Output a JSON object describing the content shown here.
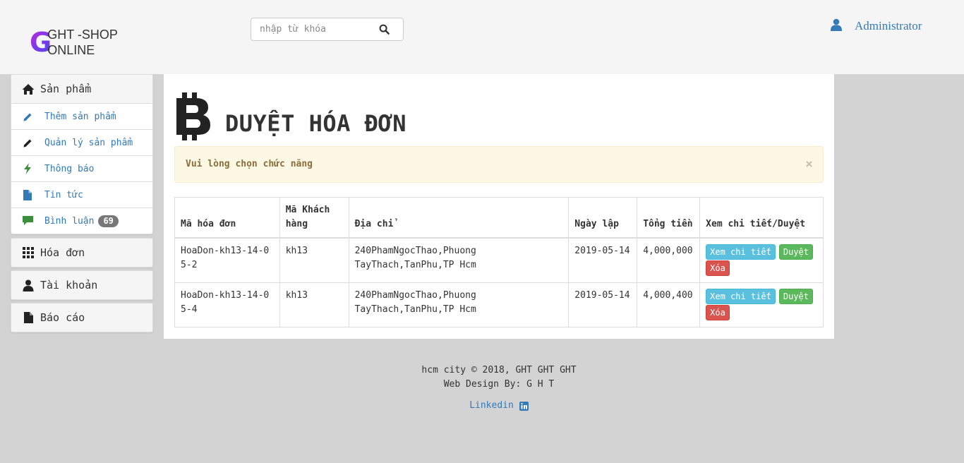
{
  "header": {
    "logo_letter": "G",
    "logo_line1": "GHT -SHOP",
    "logo_line2": "ONLINE",
    "search_placeholder": "nhập từ khóa",
    "user_name": "Administrator"
  },
  "sidebar": {
    "products": {
      "label": "Sản phẩm",
      "items": [
        {
          "label": "Thêm sản phẩm",
          "icon": "pencil-icon"
        },
        {
          "label": "Quản lý sản phẩm",
          "icon": "pencil-icon"
        },
        {
          "label": "Thông báo",
          "icon": "flash-icon"
        },
        {
          "label": "Tin tức",
          "icon": "file-icon"
        },
        {
          "label": "Bình luận",
          "icon": "comment-icon",
          "badge": "69"
        }
      ]
    },
    "invoices_label": "Hóa đơn",
    "account_label": "Tài khoản",
    "reports_label": "Báo cáo"
  },
  "main": {
    "title": "DUYỆT HÓA ĐƠN",
    "alert_text": "Vui lòng chọn chức năng",
    "alert_close": "×",
    "columns": [
      "Mã hóa đơn",
      "Mã Khách hàng",
      "Địa chỉ",
      "Ngày lập",
      "Tổng tiền",
      "Xem chi tiết/Duyệt"
    ],
    "rows": [
      {
        "id": "HoaDon-kh13-14-05-2",
        "customer": "kh13",
        "address": "240PhamNgocThao,Phuong TayThach,TanPhu,TP Hcm",
        "date": "2019-05-14",
        "total": "4,000,000"
      },
      {
        "id": "HoaDon-kh13-14-05-4",
        "customer": "kh13",
        "address": "240PhamNgocThao,Phuong TayThach,TanPhu,TP Hcm",
        "date": "2019-05-14",
        "total": "4,000,400"
      }
    ],
    "buttons": {
      "detail": "Xem chi tiết",
      "approve": "Duyệt",
      "delete": "Xóa"
    }
  },
  "footer": {
    "line1": "hcm city © 2018, GHT GHT GHT",
    "line2": "Web Design By: G H T",
    "link": "Linkedin"
  },
  "colors": {
    "link": "#337ab7",
    "info": "#5bc0de",
    "success": "#5cb85c",
    "danger": "#d9534f",
    "alert_bg": "#fcf8e3"
  }
}
